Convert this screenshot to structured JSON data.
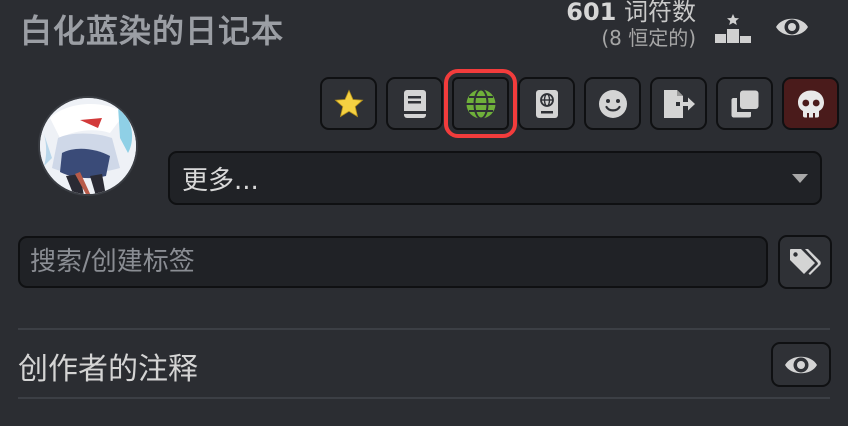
{
  "header": {
    "title": "白化蓝染的日记本",
    "token_count": "601",
    "token_unit": "词符数",
    "token_permanent": "(8 恒定的)"
  },
  "toolbar": {
    "buttons": [
      {
        "icon": "star-icon",
        "active": false
      },
      {
        "icon": "book-icon",
        "active": false
      },
      {
        "icon": "globe-icon",
        "active": true
      },
      {
        "icon": "passport-icon",
        "active": false
      },
      {
        "icon": "smile-icon",
        "active": false
      },
      {
        "icon": "file-export-icon",
        "active": false
      },
      {
        "icon": "clone-icon",
        "active": false
      },
      {
        "icon": "skull-icon",
        "active": false
      }
    ]
  },
  "more_select": {
    "selected": "更多..."
  },
  "tags": {
    "placeholder": "搜索/创建标签"
  },
  "notes": {
    "label": "创作者的注释"
  },
  "colors": {
    "background": "#2b2d32",
    "star": "#f5d142",
    "globe": "#6fb03a",
    "highlight": "#f23c3c",
    "danger_bg": "#4a1b1b"
  }
}
